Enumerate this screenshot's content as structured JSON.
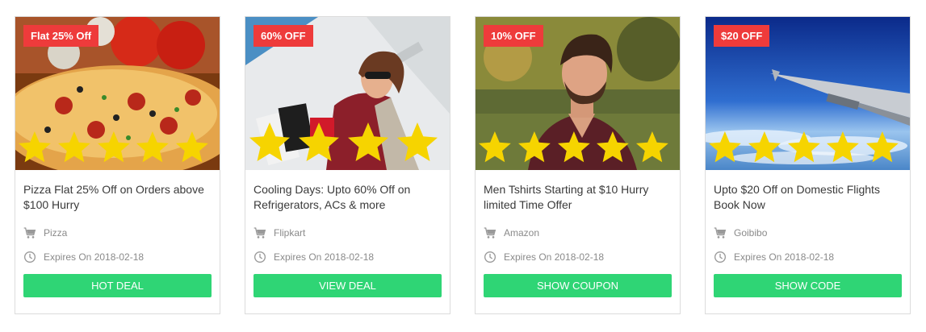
{
  "deals": [
    {
      "badge": "Flat 25% Off",
      "rating": 5,
      "title": "Pizza Flat 25% Off on Orders above $100 Hurry",
      "store": "Pizza",
      "expiry": "Expires On 2018-02-18",
      "button": "HOT DEAL",
      "image": "pizza-photo"
    },
    {
      "badge": "60% OFF",
      "rating": 4,
      "title": "Cooling Days: Upto 60% Off on Refrigerators, ACs & more",
      "store": "Flipkart",
      "expiry": "Expires On 2018-02-18",
      "button": "VIEW DEAL",
      "image": "shopping-woman-photo"
    },
    {
      "badge": "10% OFF",
      "rating": 5,
      "title": "Men Tshirts Starting at $10 Hurry limited Time Offer",
      "store": "Amazon",
      "expiry": "Expires On 2018-02-18",
      "button": "SHOW COUPON",
      "image": "man-tshirt-photo"
    },
    {
      "badge": "$20 OFF",
      "rating": 5,
      "title": "Upto $20 Off on Domestic Flights Book Now",
      "store": "Goibibo",
      "expiry": "Expires On 2018-02-18",
      "button": "SHOW CODE",
      "image": "airplane-wing-photo"
    }
  ],
  "colors": {
    "badge": "#ee3b3b",
    "button": "#2fd575",
    "star": "#f6d400",
    "meta_text": "#8a8a8a"
  },
  "icons": {
    "store": "cart-icon",
    "expiry": "clock-icon",
    "rating": "star-icon"
  }
}
